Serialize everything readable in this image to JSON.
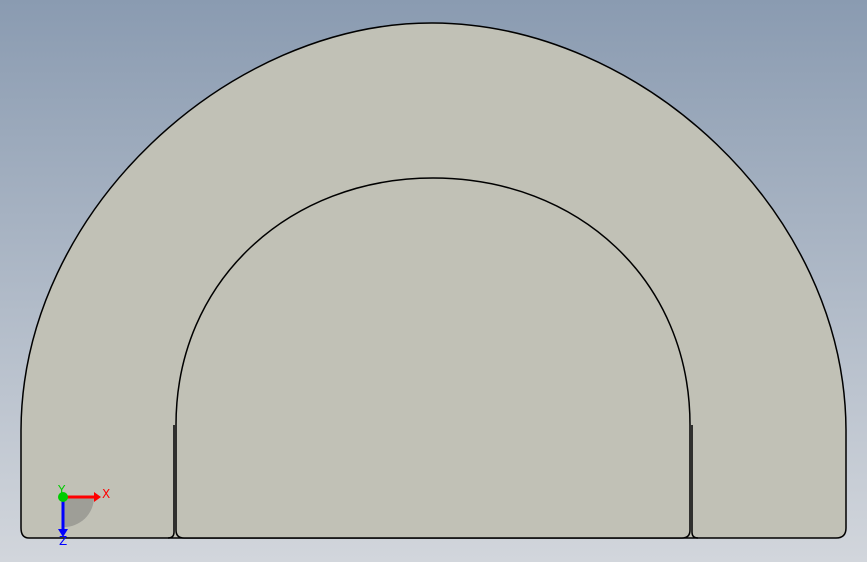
{
  "viewport": {
    "background_top": "#8a9bb1",
    "background_bottom": "#d2d6dc"
  },
  "part": {
    "face_color": "#c1c1b6",
    "edge_color": "#000000"
  },
  "triad": {
    "x_label": "X",
    "y_label": "Y",
    "z_label": "Z",
    "x_color": "#ff0000",
    "y_color": "#00cc00",
    "z_color": "#0000ff",
    "icons": [
      "axis-triad-icon"
    ]
  }
}
